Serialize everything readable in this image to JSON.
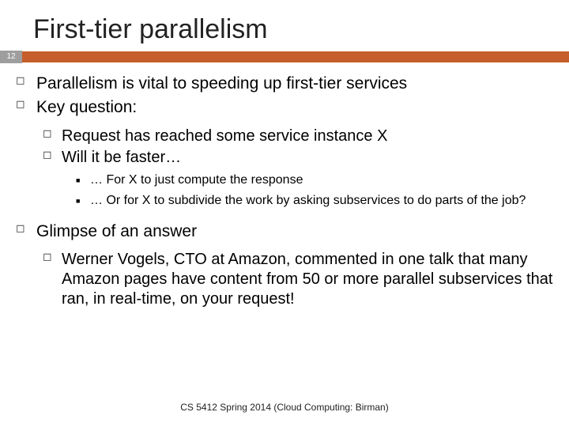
{
  "title": "First-tier parallelism",
  "page_number": "12",
  "bullets": [
    {
      "text": "Parallelism is vital to speeding up first-tier services"
    },
    {
      "text": "Key question:",
      "children": [
        {
          "text": "Request has reached some service instance X"
        },
        {
          "text": "Will it be faster…",
          "children": [
            {
              "text": "… For X to just compute the response"
            },
            {
              "text": "… Or for X to subdivide the work by asking subservices to do parts of the job?"
            }
          ]
        }
      ]
    },
    {
      "text": "Glimpse of an answer",
      "children": [
        {
          "text": "Werner Vogels, CTO at Amazon, commented in one talk that many Amazon pages have content from 50 or more parallel subservices that ran, in real-time, on your request!"
        }
      ]
    }
  ],
  "footer": "CS 5412 Spring 2014 (Cloud Computing: Birman)"
}
